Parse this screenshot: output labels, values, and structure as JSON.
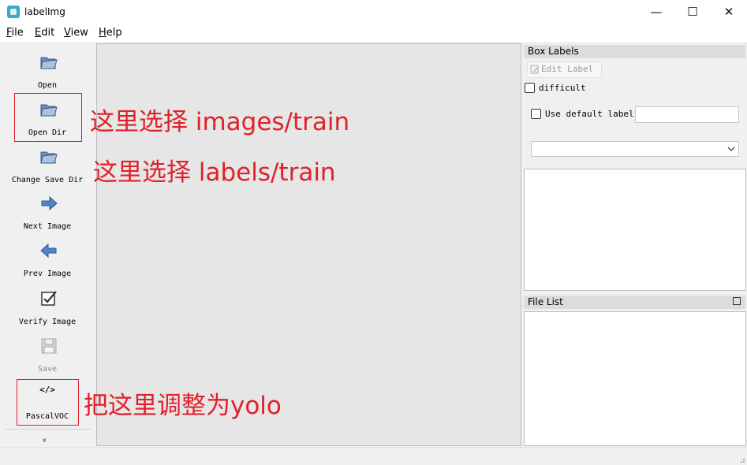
{
  "window": {
    "title": "labelImg",
    "minimize_glyph": "—",
    "maximize_glyph": "☐",
    "close_glyph": "✕"
  },
  "menu": [
    {
      "underline": "F",
      "rest": "ile"
    },
    {
      "underline": "E",
      "rest": "dit"
    },
    {
      "underline": "V",
      "rest": "iew"
    },
    {
      "underline": "H",
      "rest": "elp"
    }
  ],
  "toolbar": {
    "open": {
      "label": "Open",
      "icon": "folder-icon"
    },
    "open_dir": {
      "label": "Open Dir",
      "icon": "folder-icon"
    },
    "change_save_dir": {
      "label": "Change Save Dir",
      "icon": "folder-icon"
    },
    "next_image": {
      "label": "Next Image",
      "icon": "arrow-right-icon"
    },
    "prev_image": {
      "label": "Prev Image",
      "icon": "arrow-left-icon"
    },
    "verify_image": {
      "label": "Verify Image",
      "icon": "checkbox-icon"
    },
    "save": {
      "label": "Save",
      "icon": "floppy-icon",
      "disabled": true
    },
    "format": {
      "label": "PascalVOC",
      "icon_text": "</>"
    },
    "more_glyph": "»"
  },
  "box_labels": {
    "header": "Box Labels",
    "edit_label": "Edit Label",
    "difficult": "difficult",
    "use_default_label": "Use default label",
    "default_label_value": "",
    "combo_value": ""
  },
  "file_list": {
    "header": "File List"
  },
  "annotations": {
    "open_dir_note": "这里选择 images/train",
    "change_save_dir_note": "这里选择 labels/train",
    "format_note": "把这里调整为yolo",
    "color": "#e0202a"
  }
}
